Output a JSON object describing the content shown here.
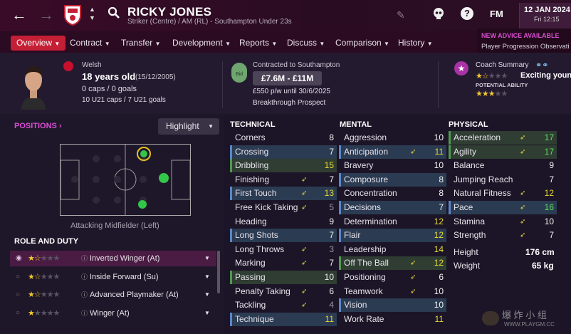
{
  "header": {
    "player_name": "RICKY JONES",
    "player_sub": "Striker (Centre) / AM (RL) - Southampton Under 23s",
    "date": "12 JAN 2024",
    "day_time": "Fri 12:15",
    "fm_label": "FM",
    "help_label": "?"
  },
  "advice": {
    "title": "NEW ADVICE AVAILABLE",
    "text": "Player Progression Observati"
  },
  "menu": [
    {
      "label": "Overview",
      "active": true
    },
    {
      "label": "Contract"
    },
    {
      "label": "Transfer"
    },
    {
      "label": "Development"
    },
    {
      "label": "Reports"
    },
    {
      "label": "Discuss"
    },
    {
      "label": "Comparison"
    },
    {
      "label": "History"
    }
  ],
  "profile": {
    "nationality": "Welsh",
    "age": "18 years old",
    "dob": "(15/12/2005)",
    "caps": "0 caps / 0 goals",
    "u21": "10 U21 caps / 7 U21 goals"
  },
  "contract": {
    "contract_line": "Contracted to Southampton",
    "bid_label": "Bid",
    "value": "£7.6M - £11M",
    "wage": "£550 p/w until 30/6/2025",
    "status": "Breakthrough Prospect"
  },
  "coach": {
    "label": "Coach Summary",
    "summary": "Exciting youn",
    "potential_label": "POTENTIAL ABILITY",
    "current_stars": 1.5,
    "potential_stars": 3
  },
  "positions": {
    "title": "POSITIONS",
    "dropdown": "Highlight",
    "caption": "Attacking Midfielder (Left)"
  },
  "role_duty": {
    "title": "ROLE AND DUTY",
    "roles": [
      {
        "label": "Inverted Winger (At)",
        "stars": 1.5
      },
      {
        "label": "Inside Forward (Su)",
        "stars": 1.5
      },
      {
        "label": "Advanced Playmaker (At)",
        "stars": 1.5
      },
      {
        "label": "Winger (At)",
        "stars": 1
      }
    ]
  },
  "technical": {
    "title": "TECHNICAL",
    "attrs": [
      {
        "name": "Corners",
        "value": "8"
      },
      {
        "name": "Crossing",
        "value": "7"
      },
      {
        "name": "Dribbling",
        "value": "15"
      },
      {
        "name": "Finishing",
        "value": "7"
      },
      {
        "name": "First Touch",
        "value": "13"
      },
      {
        "name": "Free Kick Taking",
        "value": "5"
      },
      {
        "name": "Heading",
        "value": "9"
      },
      {
        "name": "Long Shots",
        "value": "7"
      },
      {
        "name": "Long Throws",
        "value": "3"
      },
      {
        "name": "Marking",
        "value": "7"
      },
      {
        "name": "Passing",
        "value": "10"
      },
      {
        "name": "Penalty Taking",
        "value": "6"
      },
      {
        "name": "Tackling",
        "value": "4"
      },
      {
        "name": "Technique",
        "value": "11"
      }
    ]
  },
  "mental": {
    "title": "MENTAL",
    "attrs": [
      {
        "name": "Aggression",
        "value": "10"
      },
      {
        "name": "Anticipation",
        "value": "11"
      },
      {
        "name": "Bravery",
        "value": "10"
      },
      {
        "name": "Composure",
        "value": "8"
      },
      {
        "name": "Concentration",
        "value": "8"
      },
      {
        "name": "Decisions",
        "value": "7"
      },
      {
        "name": "Determination",
        "value": "12"
      },
      {
        "name": "Flair",
        "value": "12"
      },
      {
        "name": "Leadership",
        "value": "14"
      },
      {
        "name": "Off The Ball",
        "value": "12"
      },
      {
        "name": "Positioning",
        "value": "6"
      },
      {
        "name": "Teamwork",
        "value": "10"
      },
      {
        "name": "Vision",
        "value": "10"
      },
      {
        "name": "Work Rate",
        "value": "11"
      }
    ]
  },
  "physical": {
    "title": "PHYSICAL",
    "attrs": [
      {
        "name": "Acceleration",
        "value": "17"
      },
      {
        "name": "Agility",
        "value": "17"
      },
      {
        "name": "Balance",
        "value": "9"
      },
      {
        "name": "Jumping Reach",
        "value": "7"
      },
      {
        "name": "Natural Fitness",
        "value": "12"
      },
      {
        "name": "Pace",
        "value": "16"
      },
      {
        "name": "Stamina",
        "value": "10"
      },
      {
        "name": "Strength",
        "value": "7"
      }
    ],
    "height_label": "Height",
    "height": "176 cm",
    "weight_label": "Weight",
    "weight": "65 kg"
  },
  "watermark": {
    "text": "爆 炸 小 组",
    "url": "WWW.PLAYGM.CC"
  },
  "colors": {
    "accent": "#c41f35",
    "highlight_row": "#2b3b52",
    "green_row": "#2f3d33",
    "yellow_value": "#e8dd35",
    "green_value": "#5be05b"
  }
}
